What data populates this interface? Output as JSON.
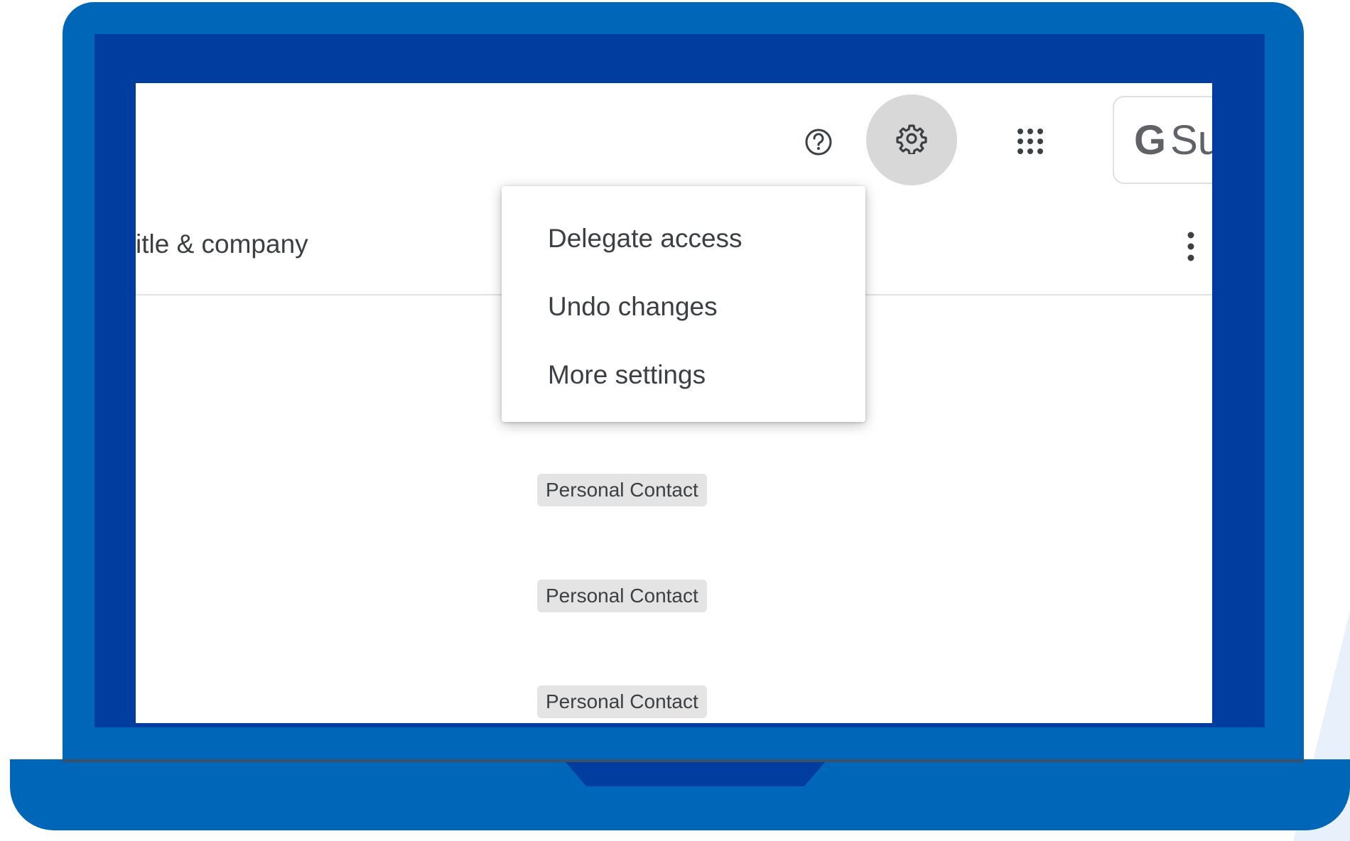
{
  "toolbar": {
    "help_icon": "help-circle-icon",
    "settings_icon": "gear-icon",
    "apps_icon": "apps-grid-icon",
    "brand_letter": "G",
    "brand_text": "Su"
  },
  "table": {
    "column_header": "itle & company",
    "more_icon": "more-vert-icon"
  },
  "settings_menu": {
    "items": [
      {
        "label": "Delegate access"
      },
      {
        "label": "Undo changes"
      },
      {
        "label": "More settings"
      }
    ]
  },
  "rows": [
    {
      "label_chip": "Personal Contact"
    },
    {
      "label_chip": "Personal Contact"
    },
    {
      "label_chip": "Personal Contact"
    }
  ],
  "colors": {
    "laptop_body": "#0066b8",
    "laptop_bezel": "#003d9e",
    "chip_bg": "#e4e4e4",
    "text": "#3c4043"
  }
}
